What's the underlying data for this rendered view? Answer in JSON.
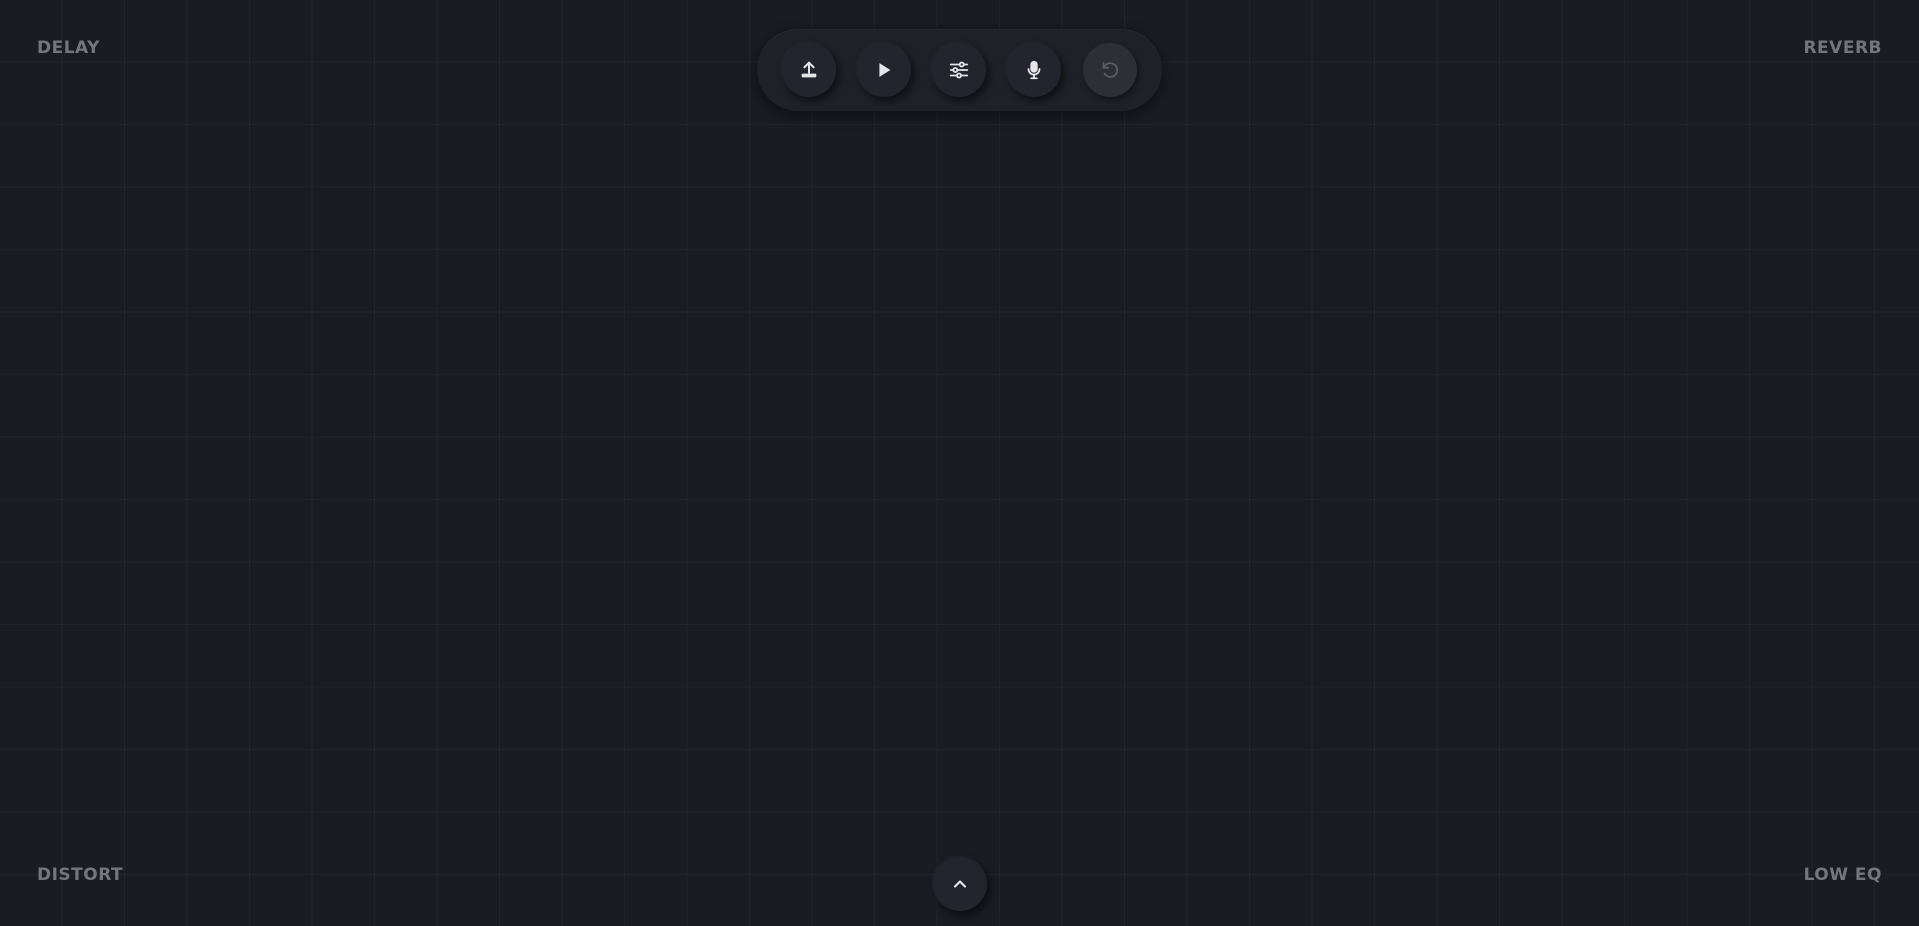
{
  "corners": {
    "top_left": "DELAY",
    "top_right": "REVERB",
    "bottom_left": "DISTORT",
    "bottom_right": "LOW EQ"
  },
  "toolbar": {
    "buttons": [
      {
        "icon": "upload-icon",
        "enabled": true
      },
      {
        "icon": "play-icon",
        "enabled": true
      },
      {
        "icon": "sliders-icon",
        "enabled": true
      },
      {
        "icon": "microphone-icon",
        "enabled": true
      },
      {
        "icon": "undo-icon",
        "enabled": false
      }
    ]
  },
  "bottom": {
    "expand_icon": "chevron-up-icon"
  },
  "colors": {
    "background": "#1a1b23",
    "panel": "#1f2028",
    "button": "#23242d",
    "icon": "#e6e6ea",
    "icon_disabled": "#5b5c63",
    "label": "#75767c"
  }
}
